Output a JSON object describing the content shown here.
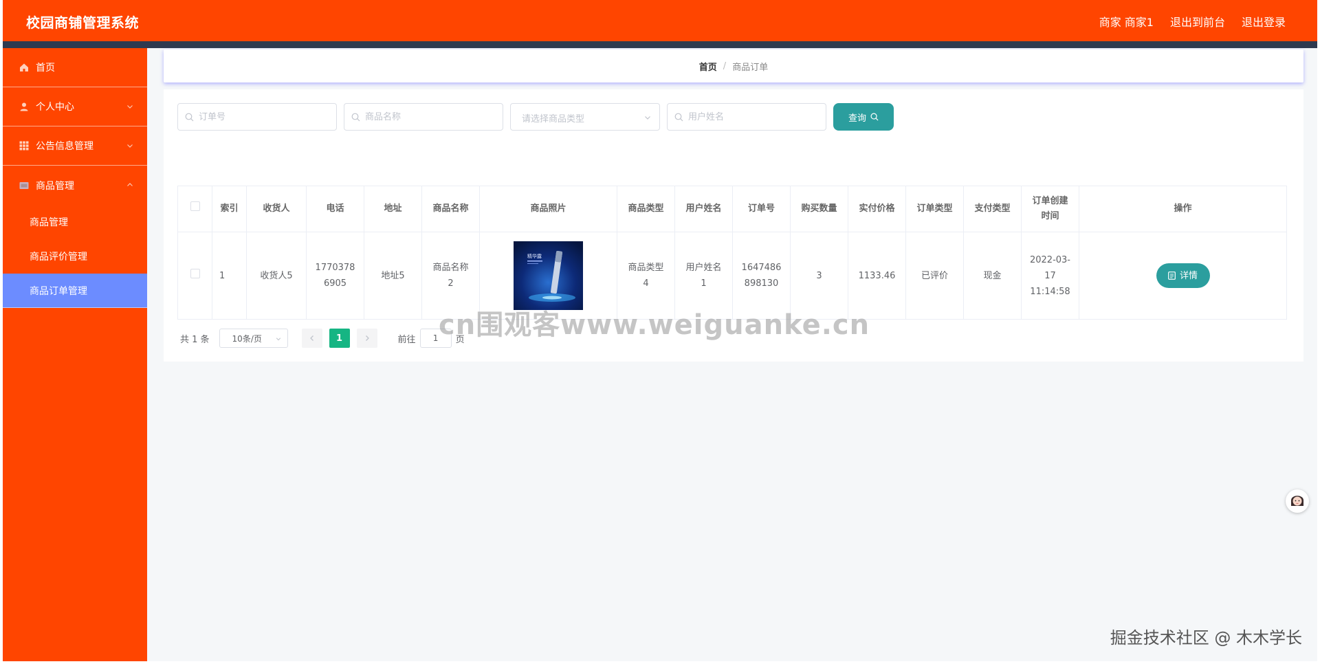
{
  "header": {
    "title": "校园商铺管理系统",
    "user": "商家 商家1",
    "front_link": "退出到前台",
    "logout": "退出登录"
  },
  "sidebar": {
    "items": [
      {
        "label": "首页",
        "icon": "home-icon"
      },
      {
        "label": "个人中心",
        "icon": "user-icon"
      },
      {
        "label": "公告信息管理",
        "icon": "grid-icon"
      },
      {
        "label": "商品管理",
        "icon": "shop-icon"
      }
    ],
    "sub_items": [
      {
        "label": "商品管理"
      },
      {
        "label": "商品评价管理"
      },
      {
        "label": "商品订单管理"
      }
    ]
  },
  "breadcrumb": {
    "home": "首页",
    "separator": "/",
    "current": "商品订单"
  },
  "search": {
    "order_no_placeholder": "订单号",
    "product_name_placeholder": "商品名称",
    "type_placeholder": "请选择商品类型",
    "user_name_placeholder": "用户姓名",
    "query_label": "查询"
  },
  "table": {
    "columns": [
      "索引",
      "收货人",
      "电话",
      "地址",
      "商品名称",
      "商品照片",
      "商品类型",
      "用户姓名",
      "订单号",
      "购买数量",
      "实付价格",
      "订单类型",
      "支付类型",
      "订单创建时间",
      "操作"
    ],
    "rows": [
      {
        "index": "1",
        "receiver": "收货人5",
        "phone": "17703786905",
        "address": "地址5",
        "product_name": "商品名称2",
        "product_type": "商品类型4",
        "user_name": "用户姓名1",
        "order_no": "1647486898130",
        "quantity": "3",
        "price": "1133.46",
        "order_type": "已评价",
        "pay_type": "现金",
        "created": "2022-03-17 11:14:58",
        "action": "详情"
      }
    ]
  },
  "pagination": {
    "total": "共 1 条",
    "page_size": "10条/页",
    "current_page": "1",
    "goto_label": "前往",
    "goto_value": "1",
    "goto_unit": "页"
  },
  "watermarks": {
    "center": "cn围观客www.weiguanke.cn",
    "corner": "掘金技术社区 @ 木木学长"
  },
  "colors": {
    "primary": "#ff4500",
    "header_bar": "#2f3a4f",
    "active_menu": "#6c8cff",
    "button": "#2b9e9e",
    "pager_active": "#16b583"
  }
}
